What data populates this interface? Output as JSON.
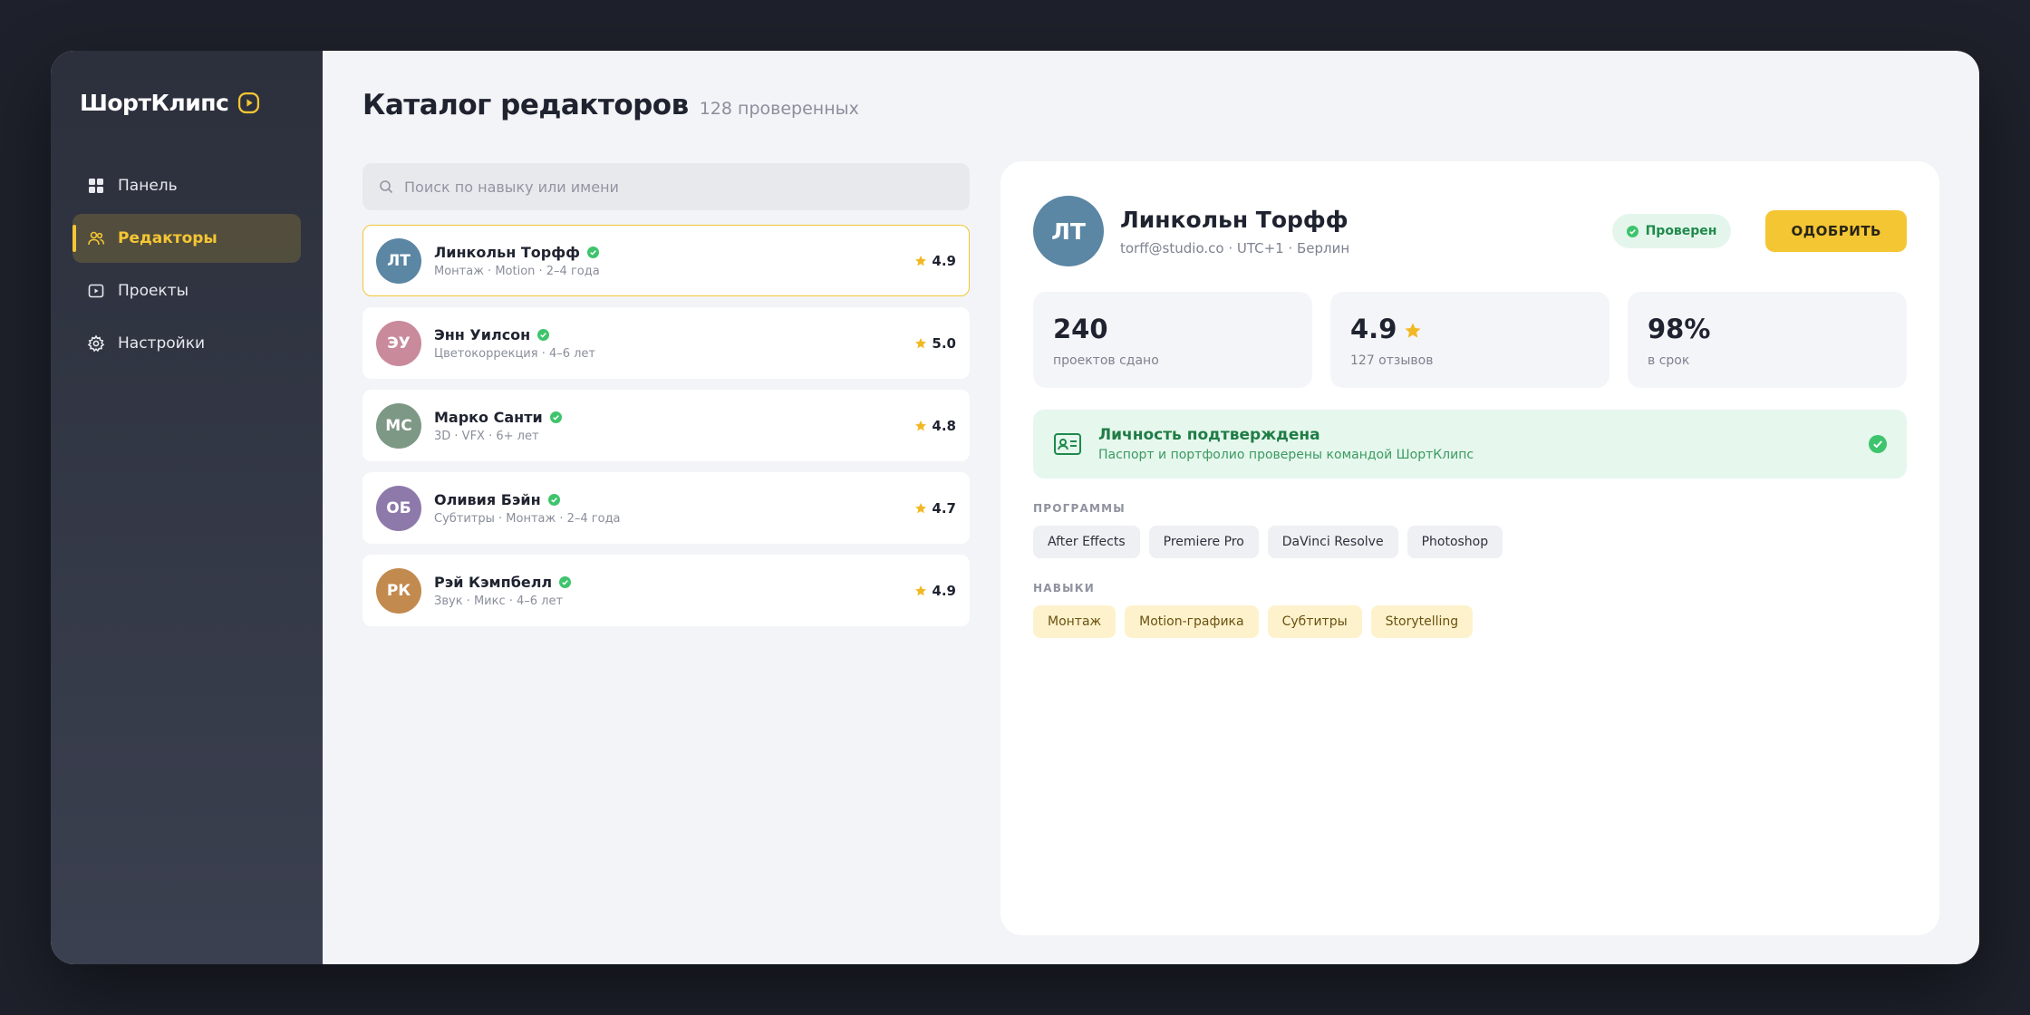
{
  "app": {
    "brand": "ШортКлипс",
    "accent": "#f5c634"
  },
  "sidebar": {
    "items": [
      {
        "label": "Панель",
        "icon": "grid-icon"
      },
      {
        "label": "Редакторы",
        "icon": "users-icon",
        "active": true
      },
      {
        "label": "Проекты",
        "icon": "play-square-icon"
      },
      {
        "label": "Настройки",
        "icon": "gear-icon"
      }
    ]
  },
  "header": {
    "title": "Каталог редакторов",
    "subtitle": "128 проверенных"
  },
  "search": {
    "placeholder": "Поиск по навыку или имени",
    "value": ""
  },
  "editors": [
    {
      "initials": "ЛТ",
      "name": "Линкольн Торфф",
      "meta": "Монтаж · Motion · 2–4 года",
      "rating": "4.9",
      "color": "#5b86a4",
      "selected": true
    },
    {
      "initials": "ЭУ",
      "name": "Энн Уилсон",
      "meta": "Цветокоррекция · 4–6 лет",
      "rating": "5.0",
      "color": "#c98a9c"
    },
    {
      "initials": "МС",
      "name": "Марко Санти",
      "meta": "3D · VFX · 6+ лет",
      "rating": "4.8",
      "color": "#7e9886"
    },
    {
      "initials": "ОБ",
      "name": "Оливия Бэйн",
      "meta": "Субтитры · Монтаж · 2–4 года",
      "rating": "4.7",
      "color": "#8d7aab"
    },
    {
      "initials": "РК",
      "name": "Рэй Кэмпбелл",
      "meta": "Звук · Микс · 4–6 лет",
      "rating": "4.9",
      "color": "#c28a4e"
    }
  ],
  "detail": {
    "initials": "ЛТ",
    "name": "Линкольн Торфф",
    "contact": "torff@studio.co · UTC+1 · Берлин",
    "badge": "Проверен",
    "approve_label": "ОДОБРИТЬ",
    "stats": [
      {
        "value": "240",
        "label": "проектов сдано"
      },
      {
        "value": "4.9",
        "label": "127 отзывов",
        "star": true
      },
      {
        "value": "98%",
        "label": "в срок"
      }
    ],
    "identity": {
      "title": "Личность подтверждена",
      "desc": "Паспорт и портфолио проверены командой ШортКлипс"
    },
    "programs_label": "ПРОГРАММЫ",
    "programs": [
      "After Effects",
      "Premiere Pro",
      "DaVinci Resolve",
      "Photoshop"
    ],
    "skills_label": "НАВЫКИ",
    "skills": [
      "Монтаж",
      "Motion-графика",
      "Субтитры",
      "Storytelling"
    ]
  }
}
